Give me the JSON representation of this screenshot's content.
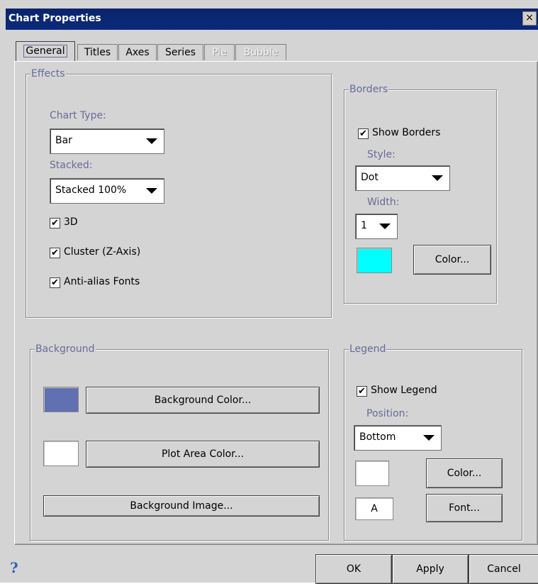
{
  "window": {
    "title": "Chart Properties",
    "close_glyph": "×"
  },
  "tabs": [
    {
      "label": "General",
      "state": "active"
    },
    {
      "label": "Titles",
      "state": "enabled"
    },
    {
      "label": "Axes",
      "state": "enabled"
    },
    {
      "label": "Series",
      "state": "enabled"
    },
    {
      "label": "Pie",
      "state": "disabled"
    },
    {
      "label": "Bubble",
      "state": "disabled"
    }
  ],
  "effects": {
    "legend": "Effects",
    "chart_type_label": "Chart Type:",
    "chart_type_value": "Bar",
    "stacked_label": "Stacked:",
    "stacked_value": "Stacked 100%",
    "threed_label": "3D",
    "threed_checked": true,
    "cluster_label": "Cluster (Z-Axis)",
    "cluster_checked": true,
    "antialias_label": "Anti-alias Fonts",
    "antialias_checked": true
  },
  "borders": {
    "legend": "Borders",
    "show_label": "Show Borders",
    "show_checked": true,
    "style_label": "Style:",
    "style_value": "Dot",
    "width_label": "Width:",
    "width_value": "1",
    "swatch_color": "#00ffff",
    "color_button": "Color..."
  },
  "background": {
    "legend": "Background",
    "bg_swatch_color": "#6070b0",
    "bg_color_button": "Background Color...",
    "plot_swatch_color": "#ffffff",
    "plot_color_button": "Plot Area Color...",
    "image_button": "Background Image..."
  },
  "legend_group": {
    "legend": "Legend",
    "show_label": "Show Legend",
    "show_checked": true,
    "position_label": "Position:",
    "position_value": "Bottom",
    "swatch_color": "#ffffff",
    "color_button": "Color...",
    "font_preview": "A",
    "font_button": "Font..."
  },
  "footer": {
    "help_icon": "help-icon",
    "ok": "OK",
    "apply": "Apply",
    "cancel": "Cancel"
  },
  "check_glyph": "✔"
}
